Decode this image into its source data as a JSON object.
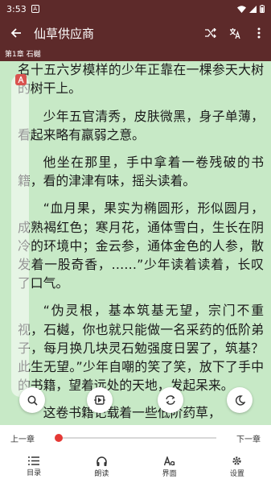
{
  "status": {
    "time": "3:53",
    "notif": "A"
  },
  "appbar": {
    "title": "仙草供应商",
    "back_icon": "arrow-left-icon",
    "actions": [
      "shuffle-icon",
      "translate-icon",
      "more-vert-icon"
    ]
  },
  "chapter": {
    "label": "第1章 石樾"
  },
  "reader": {
    "paragraphs": [
      "大唐，古州双蓝山脉外围的某座山峰上，一名十五六岁模样的少年正靠在一棵参天大树的树干上。",
      "少年五官清秀，皮肤微黑，身子单薄，看起来略有羸弱之意。",
      "他坐在那里，手中拿着一卷残破的书籍，看的津津有味，摇头读着。",
      "“血月果，果实为椭圆形，形似圆月，成熟褐红色；寒月花，通体雪白，生长在阴冷的环境中；金云参，通体金色的人参，散发着一股奇香，……”少年读着读着，长叹了口气。",
      "“伪灵根，基本筑基无望，宗门不重视，石樾，你也就只能做一名采药的低阶弟子，每月换几块灵石勉强度日罢了，筑基？此生无望。”少年自嘲的笑了笑，放下了手中的书籍，望着远处的天地，发起呆来。",
      "这卷书籍记载着一些低阶药草，"
    ]
  },
  "fabs": [
    "search-icon",
    "auto-page-icon",
    "replace-icon",
    "night-mode-icon"
  ],
  "progress": {
    "prev_label": "上一章",
    "next_label": "下一章",
    "value": 0.0
  },
  "bottomnav": [
    {
      "label": "目录",
      "icon": "list-icon"
    },
    {
      "label": "朗读",
      "icon": "headphones-icon"
    },
    {
      "label": "界面",
      "icon": "font-icon"
    },
    {
      "label": "设置",
      "icon": "gear-icon"
    }
  ]
}
